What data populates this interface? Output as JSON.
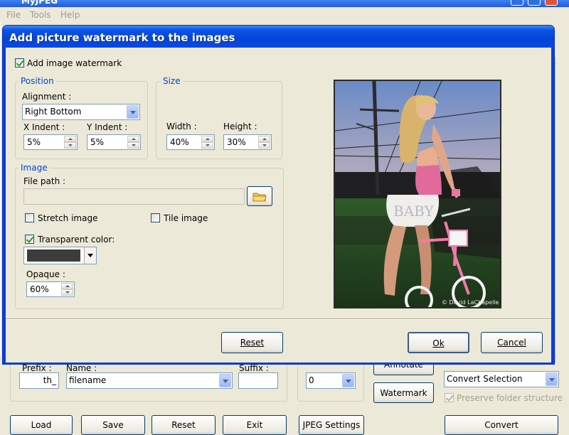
{
  "app": {
    "title": "MyJPEG",
    "menu": [
      "File",
      "Tools",
      "Help"
    ]
  },
  "dialog": {
    "title": "Add picture watermark to the images",
    "add_watermark_label": "Add image watermark",
    "add_watermark_checked": true,
    "position": {
      "title": "Position",
      "alignment_label": "Alignment :",
      "alignment_value": "Right Bottom",
      "x_indent_label": "X Indent :",
      "x_indent_value": "5%",
      "y_indent_label": "Y Indent :",
      "y_indent_value": "5%"
    },
    "size": {
      "title": "Size",
      "width_label": "Width :",
      "width_value": "40%",
      "height_label": "Height :",
      "height_value": "30%"
    },
    "image": {
      "title": "Image",
      "file_path_label": "File path :",
      "file_path_value": "",
      "stretch_label": "Stretch image",
      "stretch_checked": false,
      "tile_label": "Tile image",
      "tile_checked": false,
      "transparent_label": "Transparent color:",
      "transparent_checked": true,
      "transparent_color": "#3c3c3c",
      "opaque_label": "Opaque :",
      "opaque_value": "60%"
    },
    "preview": {
      "shorts_text": "BABY",
      "credit_text": "© David LaChapelle"
    },
    "buttons": {
      "reset": "Reset",
      "ok": "Ok",
      "cancel": "Cancel"
    }
  },
  "main_bottom": {
    "prefix_label": "Prefix :",
    "prefix_value": "th_",
    "name_label": "Name :",
    "name_value": "filename",
    "suffix_label": "Suffix :",
    "suffix_value": "",
    "number_value": "0",
    "annotate_button": "Annotate",
    "watermark_button": "Watermark",
    "convert_select_value": "Convert Selection",
    "preserve_label": "Preserve folder structure",
    "buttons": {
      "load": "Load",
      "save": "Save",
      "reset": "Reset",
      "exit": "Exit",
      "jpeg_settings": "JPEG Settings",
      "convert": "Convert"
    }
  },
  "colors": {
    "titlebar_blue": "#0345d9",
    "group_title_blue": "#0046d5",
    "window_face": "#ece9d8"
  }
}
